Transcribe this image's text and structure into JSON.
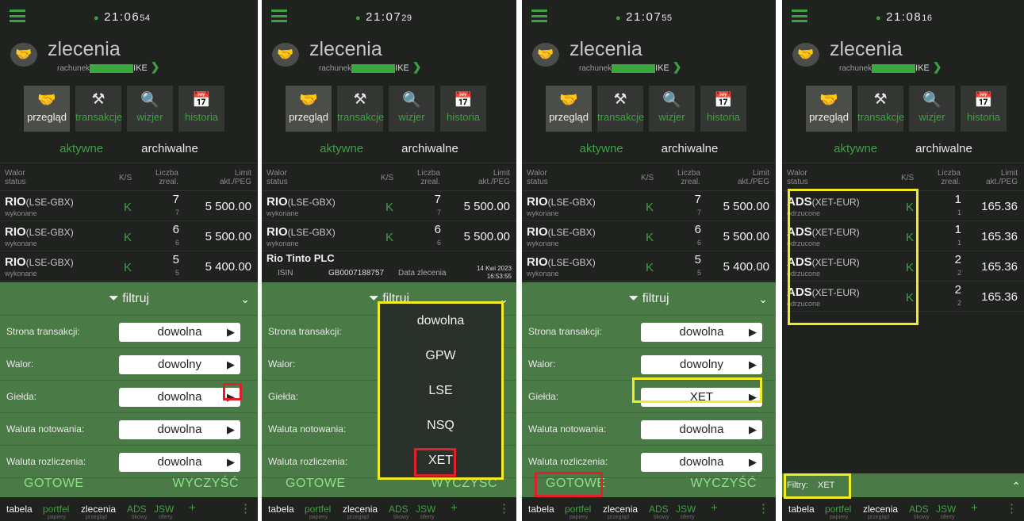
{
  "panels": [
    {
      "time": "21:06",
      "secs": "54"
    },
    {
      "time": "21:07",
      "secs": "29"
    },
    {
      "time": "21:07",
      "secs": "55"
    },
    {
      "time": "21:08",
      "secs": "16"
    }
  ],
  "header": {
    "title": "zlecenia",
    "account_label": "rachunek",
    "account_suffix": "IKE"
  },
  "tabs": [
    "przegląd",
    "transakcje",
    "wizjer",
    "historia"
  ],
  "subtabs": {
    "active": "aktywne",
    "archive": "archiwalne"
  },
  "table_headers": {
    "walor": "Walor",
    "status": "status",
    "ks": "K/S",
    "liczba": "Liczba",
    "zreal": "zreal.",
    "limit": "Limit",
    "akt": "akt./PEG"
  },
  "rows_rio": [
    {
      "walor": "RIO",
      "market": "(LSE-GBX)",
      "status": "wykonane",
      "ks": "K",
      "qty": "7",
      "real": "7",
      "limit": "5 500.00"
    },
    {
      "walor": "RIO",
      "market": "(LSE-GBX)",
      "status": "wykonane",
      "ks": "K",
      "qty": "6",
      "real": "6",
      "limit": "5 500.00"
    },
    {
      "walor": "RIO",
      "market": "(LSE-GBX)",
      "status": "wykonane",
      "ks": "K",
      "qty": "5",
      "real": "5",
      "limit": "5 400.00"
    }
  ],
  "rows_ads": [
    {
      "walor": "ADS",
      "market": "(XET-EUR)",
      "status": "odrzucone",
      "ks": "K",
      "qty": "1",
      "real": "1",
      "limit": "165.36"
    },
    {
      "walor": "ADS",
      "market": "(XET-EUR)",
      "status": "odrzucone",
      "ks": "K",
      "qty": "1",
      "real": "1",
      "limit": "165.36"
    },
    {
      "walor": "ADS",
      "market": "(XET-EUR)",
      "status": "odrzucone",
      "ks": "K",
      "qty": "2",
      "real": "2",
      "limit": "165.36"
    },
    {
      "walor": "ADS",
      "market": "(XET-EUR)",
      "status": "odrzucone",
      "ks": "K",
      "qty": "2",
      "real": "2",
      "limit": "165.36"
    }
  ],
  "detail": {
    "name": "Rio Tinto PLC",
    "isin_label": "ISIN",
    "isin": "GB0007188757",
    "date_label": "Data zlecenia",
    "date": "14 Kwi 2023",
    "time": "16:53:55"
  },
  "filter": {
    "title": "filtruj",
    "labels": [
      "Strona transakcji:",
      "Walor:",
      "Giełda:",
      "Waluta notowania:",
      "Waluta rozliczenia:"
    ],
    "values": [
      "dowolna",
      "dowolny",
      "dowolna",
      "dowolna",
      "dowolna"
    ],
    "values_xet": [
      "dowolna",
      "dowolny",
      "XET",
      "dowolna",
      "dowolna"
    ],
    "ok": "GOTOWE",
    "clear": "WYCZYŚĆ",
    "clear_partial": "WYCZYSC"
  },
  "dropdown": [
    "dowolna",
    "GPW",
    "LSE",
    "NSQ",
    "XET"
  ],
  "active_filter": {
    "label": "Filtry:",
    "value": "XET"
  },
  "bottom_tabs": [
    {
      "label": "tabela",
      "sub": ""
    },
    {
      "label": "portfel",
      "sub": "papiery"
    },
    {
      "label": "zlecenia",
      "sub": "przegląd"
    },
    {
      "label": "ADS",
      "sub": "tikowy"
    },
    {
      "label": "JSW",
      "sub": "oferty"
    }
  ],
  "bottom_plus": "+"
}
